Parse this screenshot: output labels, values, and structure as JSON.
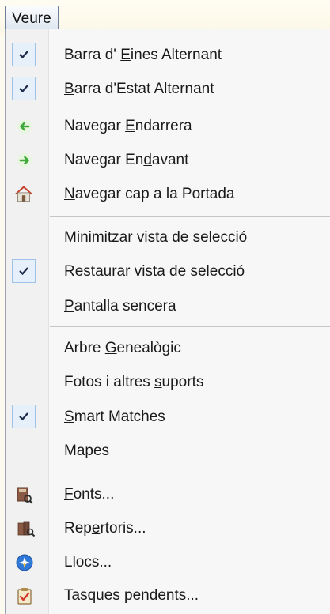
{
  "menu": {
    "title": "Veure",
    "items": [
      {
        "pre": "Barra d' ",
        "ak": "E",
        "post": "ines Alternant",
        "checked": true
      },
      {
        "pre": "",
        "ak": "B",
        "post": "arra d'Estat Alternant",
        "checked": true
      },
      {
        "pre": "Navegar ",
        "ak": "E",
        "post": "ndarrera",
        "icon": "back-arrow-icon"
      },
      {
        "pre": "Navegar En",
        "ak": "d",
        "post": "avant",
        "icon": "forward-arrow-icon"
      },
      {
        "pre": "",
        "ak": "N",
        "post": "avegar cap a la Portada",
        "icon": "home-icon"
      },
      {
        "pre": "M",
        "ak": "i",
        "post": "nimitzar vista de selecció"
      },
      {
        "pre": "Restaurar ",
        "ak": "v",
        "post": "ista de selecció",
        "checked": true
      },
      {
        "pre": "",
        "ak": "P",
        "post": "antalla sencera"
      },
      {
        "pre": "Arbre ",
        "ak": "G",
        "post": "enealògic"
      },
      {
        "pre": "Fotos i altres ",
        "ak": "s",
        "post": "uports"
      },
      {
        "pre": "",
        "ak": "S",
        "post": "mart Matches",
        "checked": true
      },
      {
        "pre": "Mapes",
        "ak": "",
        "post": ""
      },
      {
        "pre": "",
        "ak": "F",
        "post": "onts...",
        "icon": "sources-icon"
      },
      {
        "pre": "Rep",
        "ak": "e",
        "post": "rtoris...",
        "icon": "repositories-icon"
      },
      {
        "pre": "Llocs...",
        "ak": "",
        "post": "",
        "icon": "places-icon"
      },
      {
        "pre": "",
        "ak": "T",
        "post": "asques pendents...",
        "icon": "tasks-icon"
      }
    ]
  },
  "colors": {
    "check_bg": "#e6f0fb",
    "check_border": "#9fc1e8",
    "back_arrow": "#3ea838",
    "forward_arrow": "#3ea838",
    "home_roof": "#c9402a",
    "places_globe": "#2f78d8",
    "tasks_check": "#d23b2b"
  }
}
